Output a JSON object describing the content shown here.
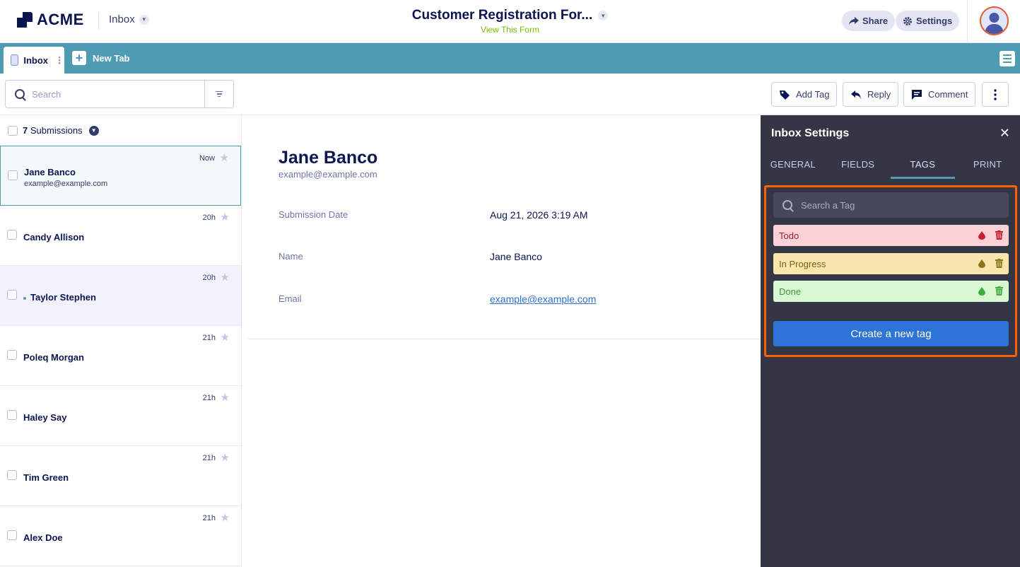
{
  "header": {
    "logo_text": "ACME",
    "inbox_label": "Inbox",
    "form_title": "Customer Registration For...",
    "form_subtitle": "View This Form",
    "share_label": "Share",
    "settings_label": "Settings"
  },
  "tabs": {
    "inbox_label": "Inbox",
    "new_tab_label": "New Tab"
  },
  "toolbar": {
    "search_placeholder": "Search",
    "add_tag_label": "Add Tag",
    "reply_label": "Reply",
    "comment_label": "Comment"
  },
  "list": {
    "count": "7",
    "count_label": "Submissions",
    "rows": [
      {
        "name": "Jane Banco",
        "email": "example@example.com",
        "time": "Now",
        "selected": true,
        "unread": false
      },
      {
        "name": "Candy Allison",
        "email": "",
        "time": "20h",
        "selected": false,
        "unread": false
      },
      {
        "name": "Taylor Stephen",
        "email": "",
        "time": "20h",
        "selected": false,
        "unread": true
      },
      {
        "name": "Poleq Morgan",
        "email": "",
        "time": "21h",
        "selected": false,
        "unread": false
      },
      {
        "name": "Haley Say",
        "email": "",
        "time": "21h",
        "selected": false,
        "unread": false
      },
      {
        "name": "Tim Green",
        "email": "",
        "time": "21h",
        "selected": false,
        "unread": false
      },
      {
        "name": "Alex Doe",
        "email": "",
        "time": "21h",
        "selected": false,
        "unread": false
      }
    ]
  },
  "detail": {
    "name": "Jane Banco",
    "email": "example@example.com",
    "fields": [
      {
        "label": "Submission Date",
        "value": "Aug 21, 2026 3:19 AM"
      },
      {
        "label": "Name",
        "value": "Jane Banco"
      },
      {
        "label": "Email",
        "value": "example@example.com"
      }
    ]
  },
  "settings_panel": {
    "title": "Inbox Settings",
    "tabs": [
      "GENERAL",
      "FIELDS",
      "TAGS",
      "PRINT"
    ],
    "active_tab": "TAGS",
    "tag_search_placeholder": "Search a Tag",
    "tags": [
      {
        "label": "Todo",
        "bg": "#f9d1d6",
        "fg": "#a3202f",
        "icon_color": "#c8202f"
      },
      {
        "label": "In Progress",
        "bg": "#f8e6ad",
        "fg": "#7d6314",
        "icon_color": "#8f7420"
      },
      {
        "label": "Done",
        "bg": "#d9f7d3",
        "fg": "#3c9a35",
        "icon_color": "#3fae3a"
      }
    ],
    "create_label": "Create a new tag"
  },
  "colors": {
    "accent": "#4f9bb3",
    "highlight_border": "#ff6100",
    "primary_button": "#2c74d8",
    "panel_bg": "#343646"
  }
}
